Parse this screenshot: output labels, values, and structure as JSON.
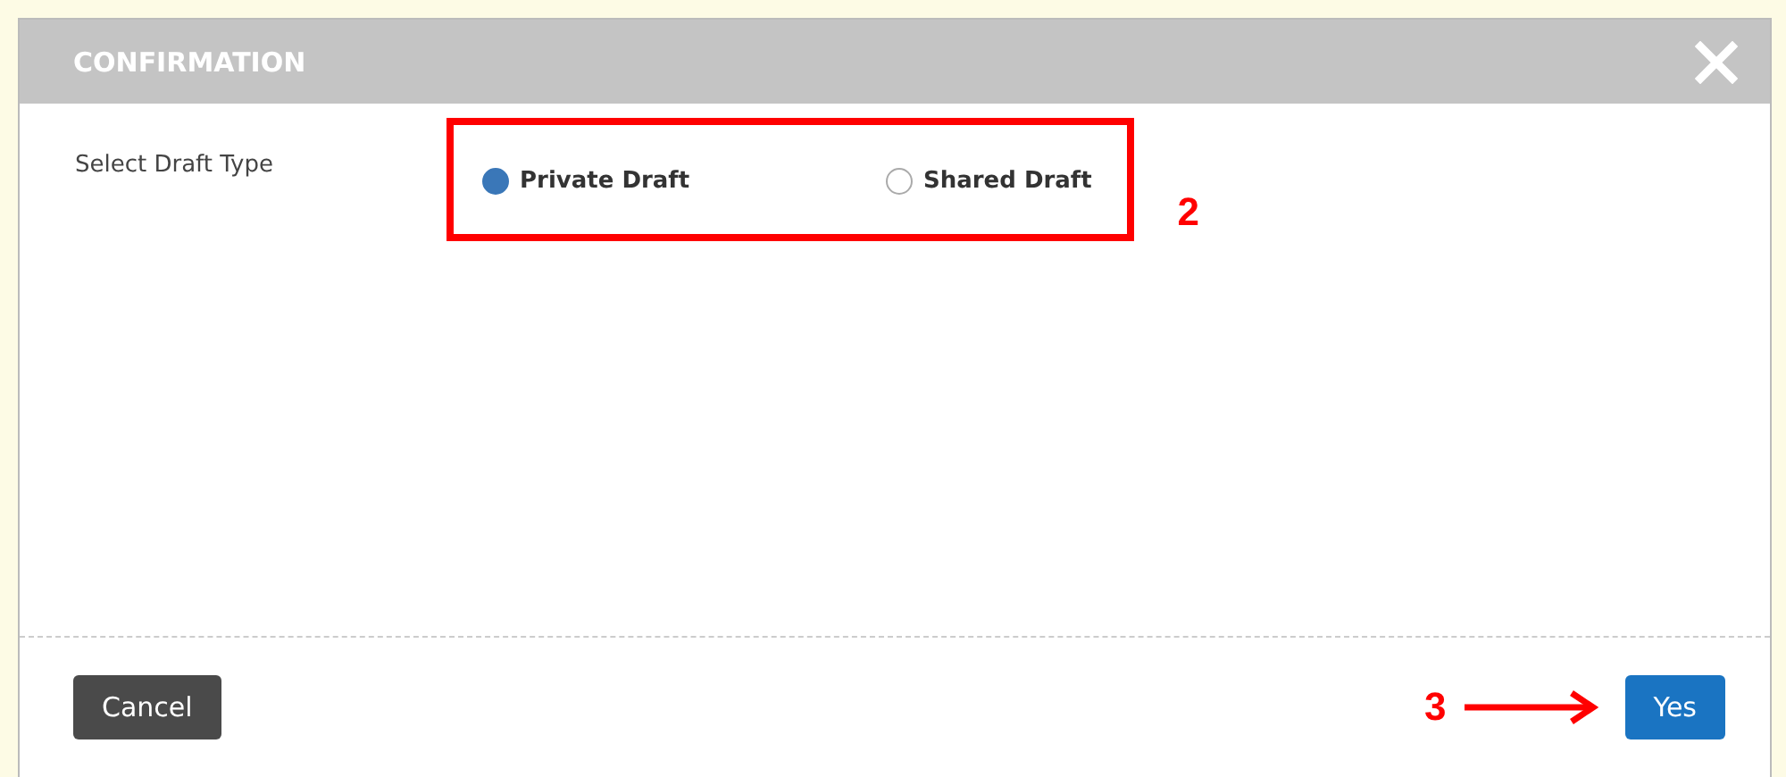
{
  "dialog": {
    "title": "CONFIRMATION",
    "field_label": "Select Draft Type",
    "options": [
      {
        "label": "Private Draft",
        "selected": true
      },
      {
        "label": "Shared Draft",
        "selected": false
      }
    ],
    "buttons": {
      "cancel": "Cancel",
      "confirm": "Yes"
    }
  },
  "annotations": [
    {
      "kind": "box",
      "label": "2"
    },
    {
      "kind": "arrow",
      "label": "3"
    }
  ]
}
